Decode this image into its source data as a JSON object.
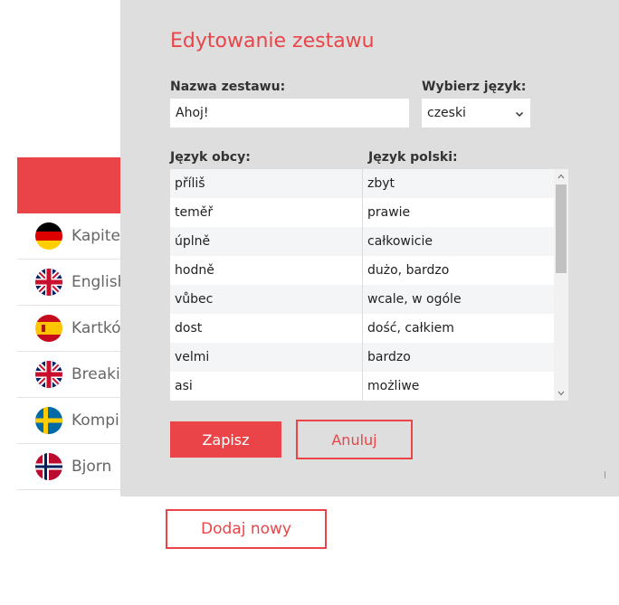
{
  "background": {
    "accent_color": "#ea4448",
    "items": [
      {
        "label": "Kapitel",
        "flag": "german-flag-icon"
      },
      {
        "label": "English",
        "flag": "uk-flag-icon"
      },
      {
        "label": "Kartkó",
        "flag": "spain-flag-icon"
      },
      {
        "label": "Breakir",
        "flag": "uk-flag-icon"
      },
      {
        "label": "Kompi",
        "flag": "sweden-flag-icon"
      },
      {
        "label": "Bjorn",
        "flag": "norway-flag-icon"
      }
    ],
    "add_new_label": "Dodaj nowy"
  },
  "modal": {
    "title": "Edytowanie zestawu",
    "name_label": "Nazwa zestawu:",
    "name_value": "Ahoj!",
    "language_label": "Wybierz język:",
    "language_value": "czeski",
    "foreign_header": "Język obcy:",
    "polish_header": "Język polski:",
    "rows": [
      {
        "foreign": "příliš",
        "polish": "zbyt"
      },
      {
        "foreign": "teměř",
        "polish": "prawie"
      },
      {
        "foreign": "úplně",
        "polish": "całkowicie"
      },
      {
        "foreign": "hodně",
        "polish": "dużo, bardzo"
      },
      {
        "foreign": "vůbec",
        "polish": "wcale, w ogóle"
      },
      {
        "foreign": "dost",
        "polish": "dość, całkiem"
      },
      {
        "foreign": "velmi",
        "polish": "bardzo"
      },
      {
        "foreign": "asi",
        "polish": "możliwe"
      }
    ],
    "save_label": "Zapisz",
    "cancel_label": "Anuluj"
  }
}
